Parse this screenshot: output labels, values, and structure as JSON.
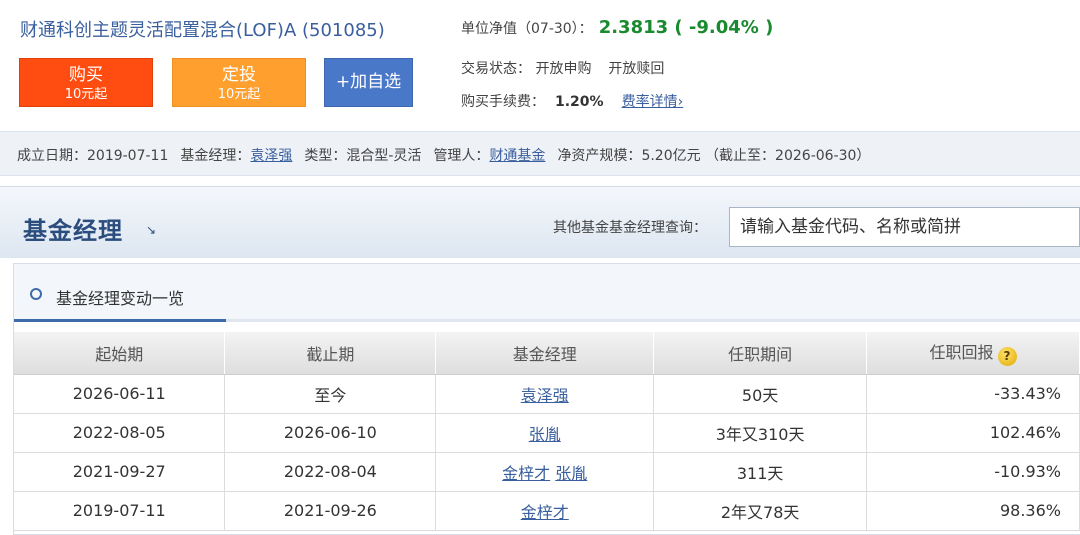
{
  "fund": {
    "title": "财通科创主题灵活配置混合(LOF)A (501085)",
    "nav_label": "单位净值（07-30）：",
    "nav_value": "2.3813 ( -9.04% )",
    "trade_status_label": "交易状态：",
    "subscribe_status": "开放申购",
    "redeem_status": "开放赎回",
    "fee_label": "购买手续费：",
    "fee_value": "1.20%",
    "fee_link": "费率详情",
    "fee_link_icon": "chevron-right-icon"
  },
  "buttons": {
    "buy_label": "购买",
    "buy_sub": "10元起",
    "dt_label": "定投",
    "dt_sub": "10元起",
    "watch_label": "+加自选"
  },
  "summary": {
    "setup_label": "成立日期：",
    "setup_date": "2019-07-11",
    "manager_label": "基金经理：",
    "manager_name": "袁泽强",
    "type_label": "类型：",
    "type_value": "混合型-灵活",
    "company_label": "管理人：",
    "company_name": "财通基金",
    "scale_label": "净资产规模：",
    "scale_value": "5.20亿元 （截止至：2026-06-30）"
  },
  "section": {
    "title": "基金经理",
    "arrow_icon": "arrow-down-right-icon",
    "query_label": "其他基金基金经理查询：",
    "query_placeholder": "请输入基金代码、名称或简拼"
  },
  "history": {
    "panel_title": "基金经理变动一览",
    "headers": [
      "起始期",
      "截止期",
      "基金经理",
      "任职期间",
      "任职回报"
    ],
    "help_icon": "question-icon",
    "rows": [
      {
        "start": "2026-06-11",
        "end": "至今",
        "managers": [
          "袁泽强"
        ],
        "duration": "50天",
        "return": "-33.43%"
      },
      {
        "start": "2022-08-05",
        "end": "2026-06-10",
        "managers": [
          "张胤"
        ],
        "duration": "3年又310天",
        "return": "102.46%"
      },
      {
        "start": "2021-09-27",
        "end": "2022-08-04",
        "managers": [
          "金梓才",
          "张胤"
        ],
        "duration": "311天",
        "return": "-10.93%"
      },
      {
        "start": "2019-07-11",
        "end": "2021-09-26",
        "managers": [
          "金梓才"
        ],
        "duration": "2年又78天",
        "return": "98.36%"
      }
    ]
  },
  "colors": {
    "buy_button": "#ff4d12",
    "dt_button": "#ff9f2e",
    "watch_button": "#4a78c8",
    "positive_return": "#c8161d",
    "negative_return": "#1a8a2e",
    "link": "#3a5f9e"
  }
}
